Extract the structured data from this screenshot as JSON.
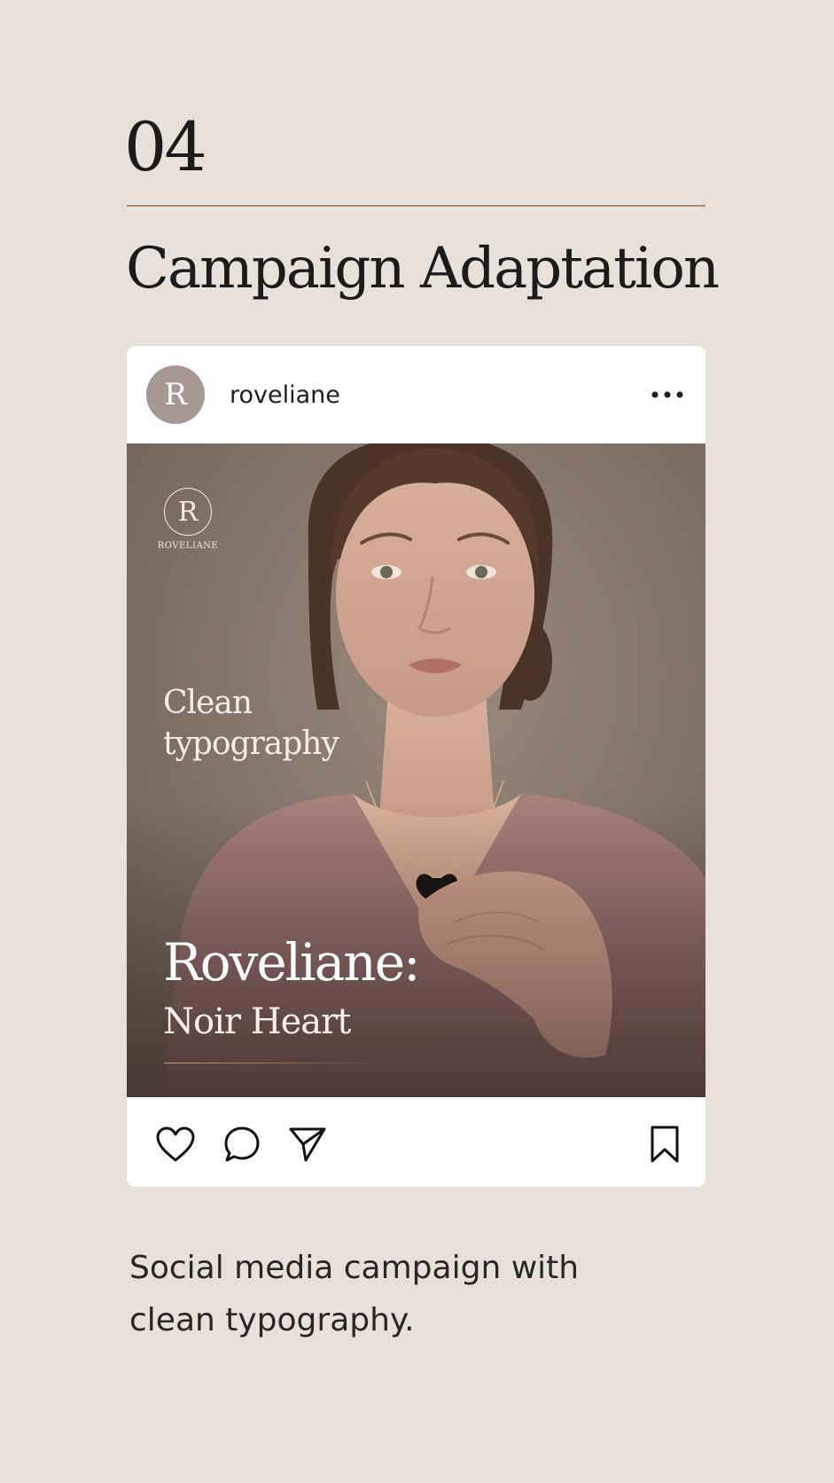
{
  "section": {
    "number": "04",
    "title": "Campaign Adaptation"
  },
  "post": {
    "avatar_letter": "R",
    "username": "roveliane",
    "more_icon": "more-dots-icon",
    "image": {
      "logo_letter": "R",
      "logo_word": "ROVELIANE",
      "tagline": "Clean typography",
      "headline": "Roveliane:",
      "subheadline": "Noir Heart"
    },
    "actions": [
      "heart-icon",
      "comment-icon",
      "share-icon",
      "bookmark-icon"
    ]
  },
  "caption": "Social media campaign with clean typography.",
  "colors": {
    "background": "#e8e1da",
    "accent_rule": "#b88a63",
    "avatar": "#a79896",
    "card": "#ffffff"
  }
}
